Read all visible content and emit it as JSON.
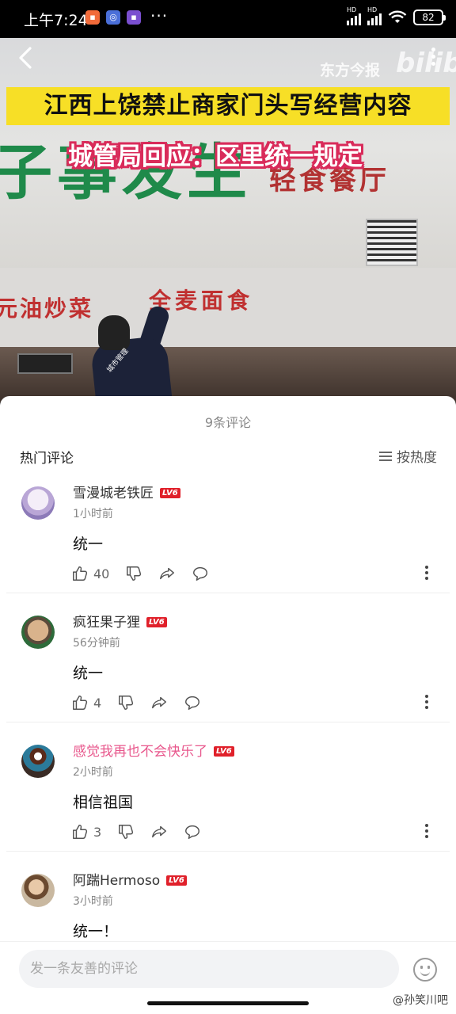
{
  "status_bar": {
    "time": "上午7:24",
    "battery": "82",
    "network_label": "HD"
  },
  "video": {
    "headline": "江西上饶禁止商家门头写经营内容",
    "subheadline": "城管局回应：区里统一规定",
    "watermark": "东方今报",
    "watermark_logo": "bilibili",
    "sign_green": "子事发生",
    "sign_sub": "轻食餐厅",
    "sign_left": "元油炒菜",
    "sign_right": "全麦面食",
    "worker_badge": "城市管理"
  },
  "comments_panel": {
    "title": "9条评论",
    "hot_label": "热门评论",
    "sort_label": "按热度"
  },
  "comments": [
    {
      "user": "雪漫城老铁匠",
      "level": "LV6",
      "time": "1小时前",
      "text": "统一",
      "likes": "40"
    },
    {
      "user": "疯狂果子狸",
      "level": "LV6",
      "time": "56分钟前",
      "text": "统一",
      "likes": "4"
    },
    {
      "user": "感觉我再也不会快乐了",
      "level": "LV6",
      "time": "2小时前",
      "text": "相信祖国",
      "likes": "3"
    },
    {
      "user": "阿踹Hermoso",
      "level": "LV6",
      "time": "3小时前",
      "text": "统一！",
      "likes": ""
    }
  ],
  "input": {
    "placeholder": "发一条友善的评论"
  },
  "credit": "@孙笑川吧",
  "colors": {
    "level_badge": "#e0202a",
    "vip_name": "#e8578c",
    "headline_bg": "#f7df26"
  }
}
